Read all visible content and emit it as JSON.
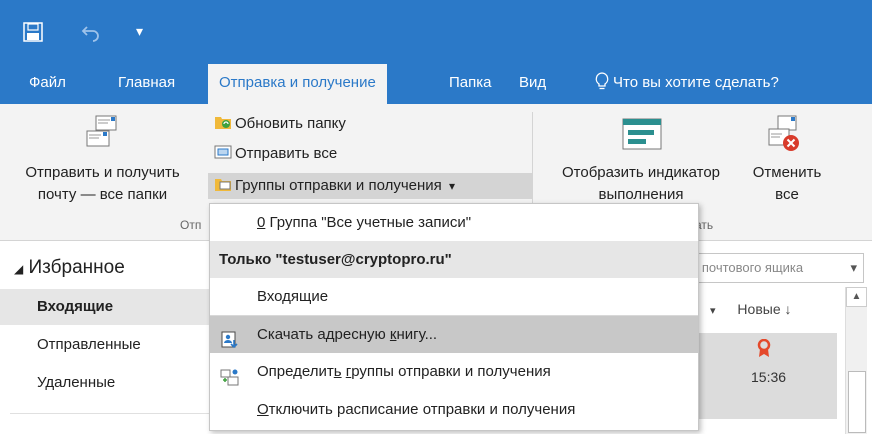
{
  "colors": {
    "brand_blue": "#2b79c8",
    "ribbon_bg": "#f3f3f3",
    "menu_hover": "#c8c8c8",
    "badge_red": "#e4492b"
  },
  "quick_access": {
    "save_icon": "save-icon",
    "undo_icon": "undo-icon",
    "customize_glyph": "▾"
  },
  "tabs": [
    {
      "label": "Файл"
    },
    {
      "label": "Главная"
    },
    {
      "label": "Отправка и получение",
      "active": true
    },
    {
      "label": "Папка"
    },
    {
      "label": "Вид"
    }
  ],
  "tell_me": {
    "placeholder": "Что вы хотите сделать?"
  },
  "ribbon": {
    "send_receive_all": {
      "line1": "Отправить и получить",
      "line2": "почту — все папки"
    },
    "update_folder": "Обновить папку",
    "send_all": "Отправить все",
    "send_receive_groups": "Группы отправки и получения",
    "send_receive_groups_arrow": "▾",
    "group_label_partial": "Отп",
    "show_progress": {
      "line1": "Отобразить индикатор",
      "line2": "выполнения"
    },
    "cancel_all": {
      "line1": "Отменить",
      "line2": "все"
    },
    "group_label_right_partial": "ать"
  },
  "favorites": {
    "title": "Избранное",
    "collapse_glyph": "◢",
    "folders": [
      {
        "label": "Входящие",
        "selected": true
      },
      {
        "label": "Отправленные",
        "selected": false
      },
      {
        "label": "Удаленные",
        "selected": false
      }
    ]
  },
  "message_list": {
    "search_scope": "о почтового ящика",
    "sort_label": "Новые",
    "sort_arrow": "↓",
    "dropdown_glyph": "▾",
    "item_time": "15:36",
    "scroll_up_glyph": "▲"
  },
  "dropdown_menu": {
    "group_all_prefix": "0",
    "group_all": " Группа \"Все учетные записи\"",
    "only_header": "Только \"testuser@cryptopro.ru\"",
    "inbox": "Входящие",
    "download_ab_pre": "Скачать адресную ",
    "download_ab_key": "к",
    "download_ab_post": "нигу...",
    "define_pre": "Определит",
    "define_key": "ь",
    "define_mid": " ",
    "define_key2": "г",
    "define_post": "руппы отправки и получения",
    "disable_key": "О",
    "disable_post": "тключить расписание отправки и получения"
  }
}
